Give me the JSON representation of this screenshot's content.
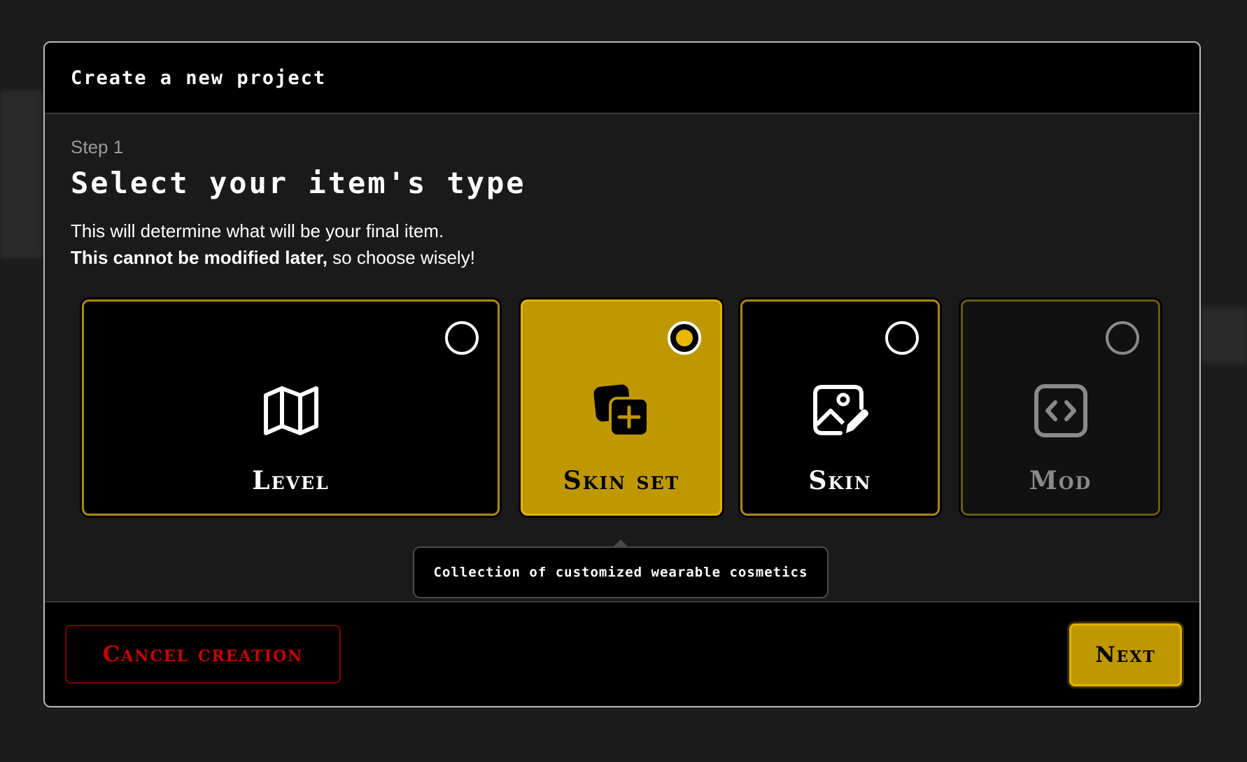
{
  "dialog": {
    "title": "Create a new project",
    "step": "Step 1",
    "heading": "Select your item's type",
    "description_line1": "This will determine what will be your final item.",
    "description_bold": "This cannot be modified later,",
    "description_rest": " so choose wisely!"
  },
  "item_types": [
    {
      "label": "Level",
      "icon": "map-icon",
      "selected": false,
      "disabled": false
    },
    {
      "label": "Skin set",
      "icon": "add-layers-icon",
      "selected": true,
      "disabled": false
    },
    {
      "label": "Skin",
      "icon": "image-edit-icon",
      "selected": false,
      "disabled": false
    },
    {
      "label": "Mod",
      "icon": "code-icon",
      "selected": false,
      "disabled": true
    }
  ],
  "tooltip": "Collection of customized wearable cosmetics",
  "footer": {
    "cancel_label": "Cancel creation",
    "next_label": "Next"
  },
  "colors": {
    "accent": "#bf9800",
    "accent_border": "#e0b400",
    "danger": "#c80000",
    "background": "#1a1a1a"
  }
}
